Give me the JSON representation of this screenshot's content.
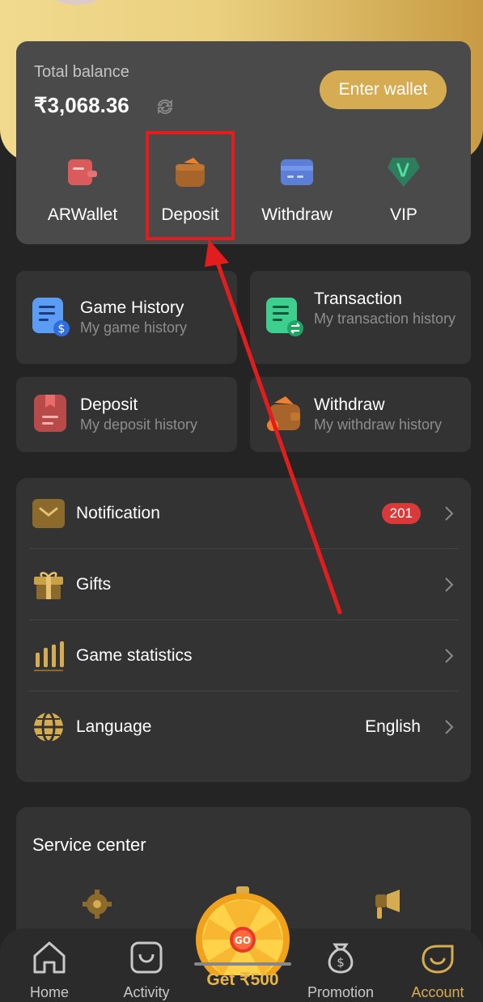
{
  "balance": {
    "label": "Total balance",
    "amount": "₹3,068.36",
    "enter_wallet": "Enter wallet"
  },
  "quick_actions": [
    {
      "label": "ARWallet",
      "icon": "arwallet-icon"
    },
    {
      "label": "Deposit",
      "icon": "deposit-wallet-icon"
    },
    {
      "label": "Withdraw",
      "icon": "withdraw-card-icon"
    },
    {
      "label": "VIP",
      "icon": "vip-icon"
    }
  ],
  "history_tiles": [
    {
      "title": "Game History",
      "sub": "My game history",
      "icon": "game-history-icon"
    },
    {
      "title": "Transaction",
      "sub": "My transaction history",
      "icon": "transaction-icon"
    },
    {
      "title": "Deposit",
      "sub": "My deposit history",
      "icon": "deposit-history-icon"
    },
    {
      "title": "Withdraw",
      "sub": "My withdraw history",
      "icon": "withdraw-history-icon"
    }
  ],
  "menu": {
    "notification": {
      "label": "Notification",
      "badge": "201"
    },
    "gifts": {
      "label": "Gifts"
    },
    "game_statistics": {
      "label": "Game statistics"
    },
    "language": {
      "label": "Language",
      "value": "English"
    }
  },
  "service_center": {
    "title": "Service center"
  },
  "tabbar": {
    "home": "Home",
    "activity": "Activity",
    "promo_wheel": "Get ₹500",
    "promotion": "Promotion",
    "account": "Account"
  },
  "colors": {
    "accent_gold": "#d6ac52",
    "highlight_red": "#e31d1d",
    "badge_red": "#d83a3a"
  }
}
